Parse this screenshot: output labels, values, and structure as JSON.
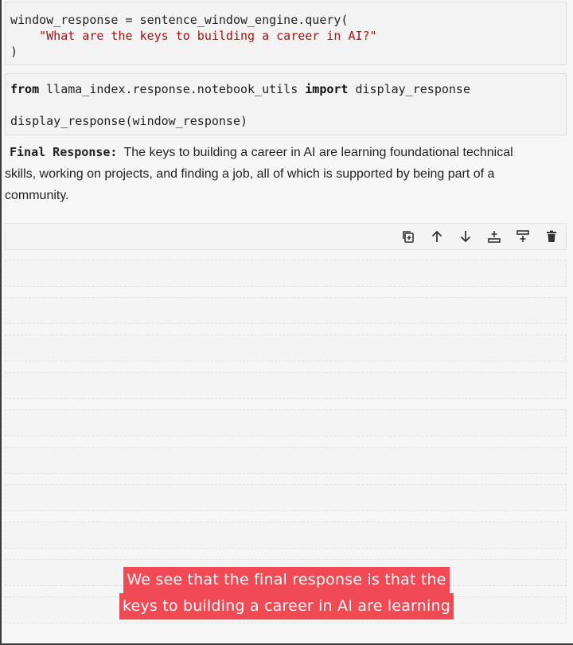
{
  "cells": {
    "code1": {
      "line1": "window_response = sentence_window_engine.query(",
      "line2_indent": "    ",
      "line2_string": "\"What are the keys to building a career in AI?\"",
      "line3": ")"
    },
    "code2": {
      "kw_from": "from",
      "module": " llama_index.response.notebook_utils ",
      "kw_import": "import",
      "name": " display_response",
      "call": "display_response(window_response)"
    },
    "output": {
      "label": "Final Response:",
      "text": "The keys to building a career in AI are learning foundational technical skills, working on projects, and finding a job, all of which is supported by being part of a community."
    }
  },
  "toolbar": {
    "icons": [
      "duplicate-icon",
      "move-up-icon",
      "move-down-icon",
      "insert-above-icon",
      "insert-below-icon",
      "delete-icon"
    ]
  },
  "caption": {
    "line1": "We see that the final response is that the",
    "line2": "keys to building a career in AI are learning"
  }
}
